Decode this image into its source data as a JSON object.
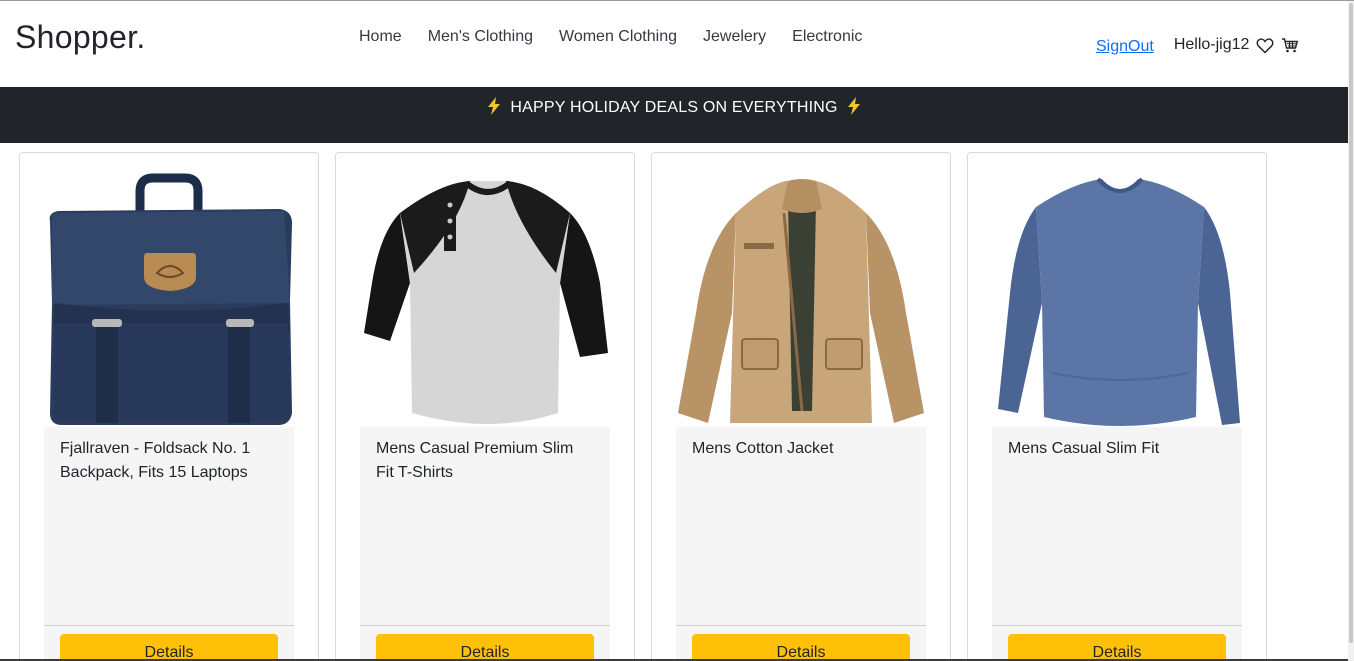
{
  "brand": "Shopper.",
  "nav": {
    "items": [
      {
        "label": "Home"
      },
      {
        "label": "Men's Clothing"
      },
      {
        "label": "Women Clothing"
      },
      {
        "label": "Jewelery"
      },
      {
        "label": "Electronic"
      }
    ]
  },
  "user": {
    "signout_label": "SignOut",
    "greeting": "Hello-jig12",
    "icons": [
      "heart-icon",
      "cart-icon"
    ]
  },
  "banner": {
    "text": "HAPPY HOLIDAY DEALS ON EVERYTHING",
    "icon": "lightning-icon",
    "icon_color": "#f4c430"
  },
  "colors": {
    "banner_bg": "#212529",
    "button_bg": "#ffc107",
    "link": "#0d6efd",
    "card_body_bg": "#f5f5f5"
  },
  "products": [
    {
      "title": "Fjallraven - Foldsack No. 1 Backpack, Fits 15 Laptops",
      "image": "navy-backpack",
      "button": "Details"
    },
    {
      "title": "Mens Casual Premium Slim Fit T-Shirts",
      "image": "raglan-henley-tshirt",
      "button": "Details"
    },
    {
      "title": "Mens Cotton Jacket",
      "image": "khaki-cotton-jacket",
      "button": "Details"
    },
    {
      "title": "Mens Casual Slim Fit",
      "image": "blue-long-sleeve-shirt",
      "button": "Details"
    }
  ]
}
